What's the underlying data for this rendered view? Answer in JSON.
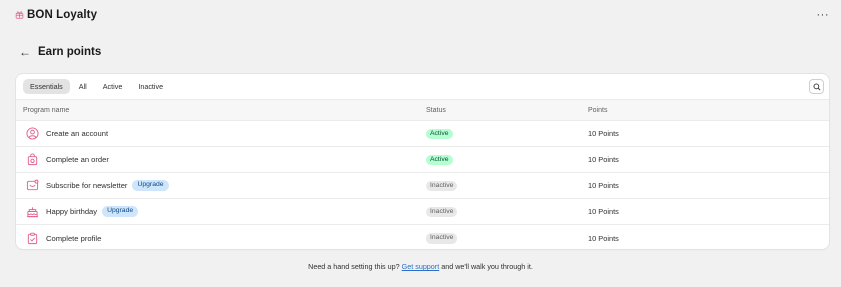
{
  "app": {
    "logo_icon": "gift-icon",
    "title": "BON Loyalty",
    "menu_label": "···"
  },
  "header": {
    "back_icon": "←",
    "title": "Earn points"
  },
  "tabs": [
    {
      "label": "Essentials",
      "selected": true
    },
    {
      "label": "All",
      "selected": false
    },
    {
      "label": "Active",
      "selected": false
    },
    {
      "label": "Inactive",
      "selected": false
    }
  ],
  "table": {
    "columns": {
      "name": "Program name",
      "status": "Status",
      "points": "Points"
    },
    "rows": [
      {
        "icon": "user-circle-icon",
        "name": "Create an account",
        "upgrade": "",
        "status": "Active",
        "points": "10 Points"
      },
      {
        "icon": "shopping-bag-icon",
        "name": "Complete an order",
        "upgrade": "",
        "status": "Active",
        "points": "10 Points"
      },
      {
        "icon": "newsletter-icon",
        "name": "Subscribe for newsletter",
        "upgrade": "Upgrade",
        "status": "Inactive",
        "points": "10 Points"
      },
      {
        "icon": "birthday-cake-icon",
        "name": "Happy birthday",
        "upgrade": "Upgrade",
        "status": "Inactive",
        "points": "10 Points"
      },
      {
        "icon": "clipboard-check-icon",
        "name": "Complete profile",
        "upgrade": "",
        "status": "Inactive",
        "points": "10 Points"
      }
    ]
  },
  "footer": {
    "text_before": "Need a hand setting this up? ",
    "link": "Get support",
    "text_after": " and we'll walk you through it."
  },
  "colors": {
    "accent_icon": "#e3608a",
    "active_bg": "#b4fed2",
    "inactive_bg": "#e8e8e8",
    "upgrade_bg": "#cfe5fb",
    "link": "#2c6ecb"
  }
}
